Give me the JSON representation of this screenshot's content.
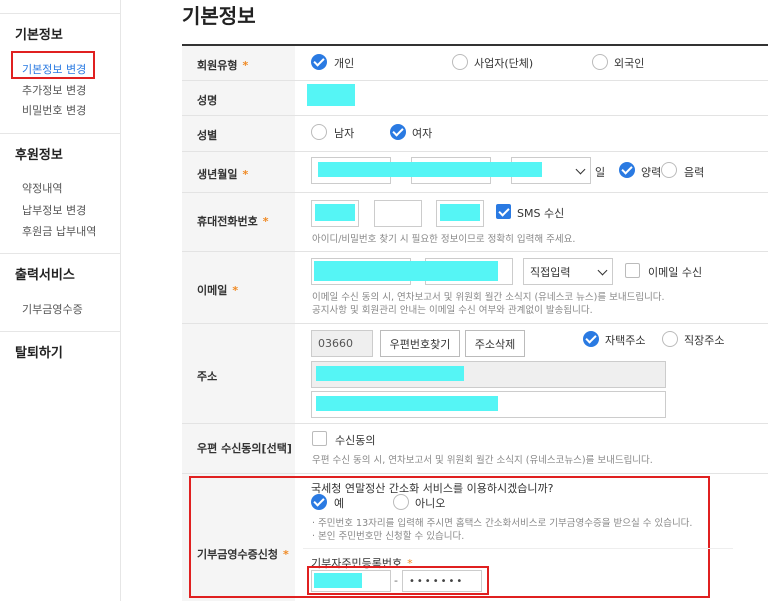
{
  "sidebar": {
    "sections": [
      {
        "title": "기본정보",
        "items": [
          "기본정보 변경",
          "추가정보 변경",
          "비밀번호 변경"
        ]
      },
      {
        "title": "후원정보",
        "items": [
          "약정내역",
          "납부정보 변경",
          "후원금 납부내역"
        ]
      },
      {
        "title": "출력서비스",
        "items": [
          "기부금영수증"
        ]
      },
      {
        "title": "탈퇴하기",
        "items": []
      }
    ]
  },
  "page_title": "기본정보",
  "form": {
    "member_type": {
      "label": "회원유형",
      "options": [
        "개인",
        "사업자(단체)",
        "외국인"
      ],
      "selected": "개인"
    },
    "name": {
      "label": "성명"
    },
    "gender": {
      "label": "성별",
      "options": [
        "남자",
        "여자"
      ],
      "selected": "여자"
    },
    "birth": {
      "label": "생년월일",
      "day_suffix": "일",
      "calendar": [
        "양력",
        "음력"
      ],
      "selected": "양력"
    },
    "phone": {
      "label": "휴대전화번호",
      "sms_label": "SMS 수신",
      "hint": "아이디/비밀번호 찾기 시 필요한 정보이므로 정확히 입력해 주세요."
    },
    "email": {
      "label": "이메일",
      "domain_select": "직접입력",
      "receive_label": "이메일 수신",
      "hint1": "이메일 수신 동의 시, 연차보고서 및 위원회 월간 소식지 (유네스코 뉴스)를 보내드립니다.",
      "hint2": "공지사항 및 회원관리 안내는 이메일 수신 여부와 관계없이 발송됩니다."
    },
    "address": {
      "label": "주소",
      "zipcode": "03660",
      "find_zip": "우편번호찾기",
      "delete_addr": "주소삭제",
      "types": [
        "자택주소",
        "직장주소"
      ],
      "selected": "자택주소"
    },
    "mail_consent": {
      "label": "우편 수신동의[선택]",
      "check_label": "수신동의",
      "hint": "우편 수신 동의 시, 연차보고서 및 위원회 월간 소식지 (유네스코뉴스)를 보내드립니다."
    },
    "receipt": {
      "label": "기부금영수증신청",
      "question": "국세청 연말정산 간소화 서비스를 이용하시겠습니까?",
      "options": [
        "예",
        "아니오"
      ],
      "selected": "예",
      "note1": "· 주민번호 13자리를 입력해 주시면 홈택스 간소화서비스로 기부금영수증을 받으실 수 있습니다.",
      "note2": "· 본인 주민번호만 신청할 수 있습니다.",
      "rrn_label": "기부자주민등록번호",
      "rrn_dash": "-",
      "rrn_back": "•••••••"
    },
    "required_mark": "*"
  }
}
